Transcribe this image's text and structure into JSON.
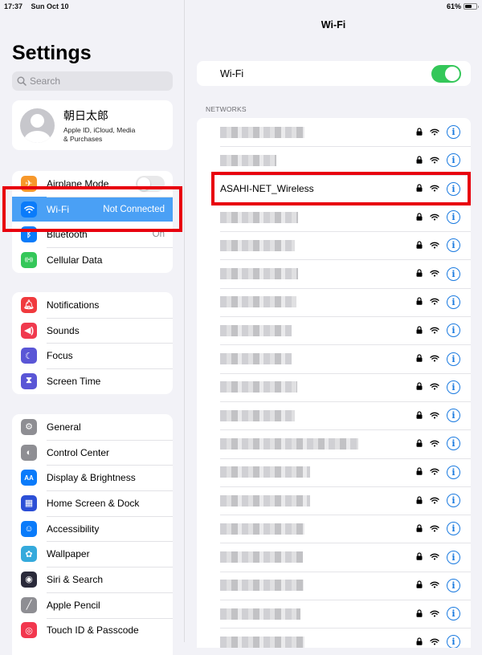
{
  "status_bar": {
    "time": "17:37",
    "date": "Sun Oct 10",
    "battery_percent_label": "61%",
    "battery_level": 0.61
  },
  "sidebar": {
    "title": "Settings",
    "search_placeholder": "Search",
    "profile": {
      "name": "朝日太郎",
      "subtitle_line1": "Apple ID, iCloud, Media",
      "subtitle_line2": "& Purchases"
    },
    "group1": [
      {
        "label": "Airplane Mode",
        "icon": "airplane-icon",
        "color": "#f7982b",
        "toggle": false
      },
      {
        "label": "Wi-Fi",
        "icon": "wifi-icon",
        "color": "#0a7bfa",
        "value": "Not Connected",
        "selected": true
      },
      {
        "label": "Bluetooth",
        "icon": "bluetooth-icon",
        "color": "#0a7bfa",
        "value": "On"
      },
      {
        "label": "Cellular Data",
        "icon": "antenna-icon",
        "color": "#34c759"
      }
    ],
    "group2": [
      {
        "label": "Notifications",
        "icon": "bell-icon",
        "color": "#f03a3e"
      },
      {
        "label": "Sounds",
        "icon": "speaker-icon",
        "color": "#f03a4e"
      },
      {
        "label": "Focus",
        "icon": "moon-icon",
        "color": "#5a56d6"
      },
      {
        "label": "Screen Time",
        "icon": "hourglass-icon",
        "color": "#5a56d6"
      }
    ],
    "group3": [
      {
        "label": "General",
        "icon": "gear-icon",
        "color": "#8e8e93"
      },
      {
        "label": "Control Center",
        "icon": "switches-icon",
        "color": "#8e8e93"
      },
      {
        "label": "Display & Brightness",
        "icon": "text-size-icon",
        "color": "#0a7bfa"
      },
      {
        "label": "Home Screen & Dock",
        "icon": "grid-icon",
        "color": "#2c4fd6"
      },
      {
        "label": "Accessibility",
        "icon": "accessibility-icon",
        "color": "#0a7bfa"
      },
      {
        "label": "Wallpaper",
        "icon": "flower-icon",
        "color": "#35aadc"
      },
      {
        "label": "Siri & Search",
        "icon": "siri-icon",
        "color": "#2a2a3a"
      },
      {
        "label": "Apple Pencil",
        "icon": "pencil-icon",
        "color": "#8e8e93"
      },
      {
        "label": "Touch ID & Passcode",
        "icon": "fingerprint-icon",
        "color": "#f2374e"
      }
    ]
  },
  "main": {
    "title": "Wi-Fi",
    "wifi_toggle_label": "Wi-Fi",
    "wifi_enabled": true,
    "networks_header": "NETWORKS",
    "networks": [
      {
        "name": "",
        "blurred": true,
        "blur_width": 105
      },
      {
        "name": "",
        "blurred": true,
        "blur_width": 70
      },
      {
        "name": "ASAHI-NET_Wireless",
        "blurred": false
      },
      {
        "name": "",
        "blurred": true,
        "blur_width": 97
      },
      {
        "name": "",
        "blurred": true,
        "blur_width": 93
      },
      {
        "name": "",
        "blurred": true,
        "blur_width": 97
      },
      {
        "name": "",
        "blurred": true,
        "blur_width": 95
      },
      {
        "name": "",
        "blurred": true,
        "blur_width": 89
      },
      {
        "name": "",
        "blurred": true,
        "blur_width": 89
      },
      {
        "name": "",
        "blurred": true,
        "blur_width": 96
      },
      {
        "name": "",
        "blurred": true,
        "blur_width": 93
      },
      {
        "name": "",
        "blurred": true,
        "blur_width": 172
      },
      {
        "name": "",
        "blurred": true,
        "blur_width": 112
      },
      {
        "name": "",
        "blurred": true,
        "blur_width": 112
      },
      {
        "name": "",
        "blurred": true,
        "blur_width": 105
      },
      {
        "name": "",
        "blurred": true,
        "blur_width": 103
      },
      {
        "name": "",
        "blurred": true,
        "blur_width": 104
      },
      {
        "name": "",
        "blurred": true,
        "blur_width": 100
      },
      {
        "name": "",
        "blurred": true,
        "blur_width": 105
      }
    ]
  },
  "colors": {
    "accent": "#0a7bfa",
    "highlight": "#e8000d",
    "toggle_on": "#34c759",
    "selected_row": "#4aa0f5"
  }
}
